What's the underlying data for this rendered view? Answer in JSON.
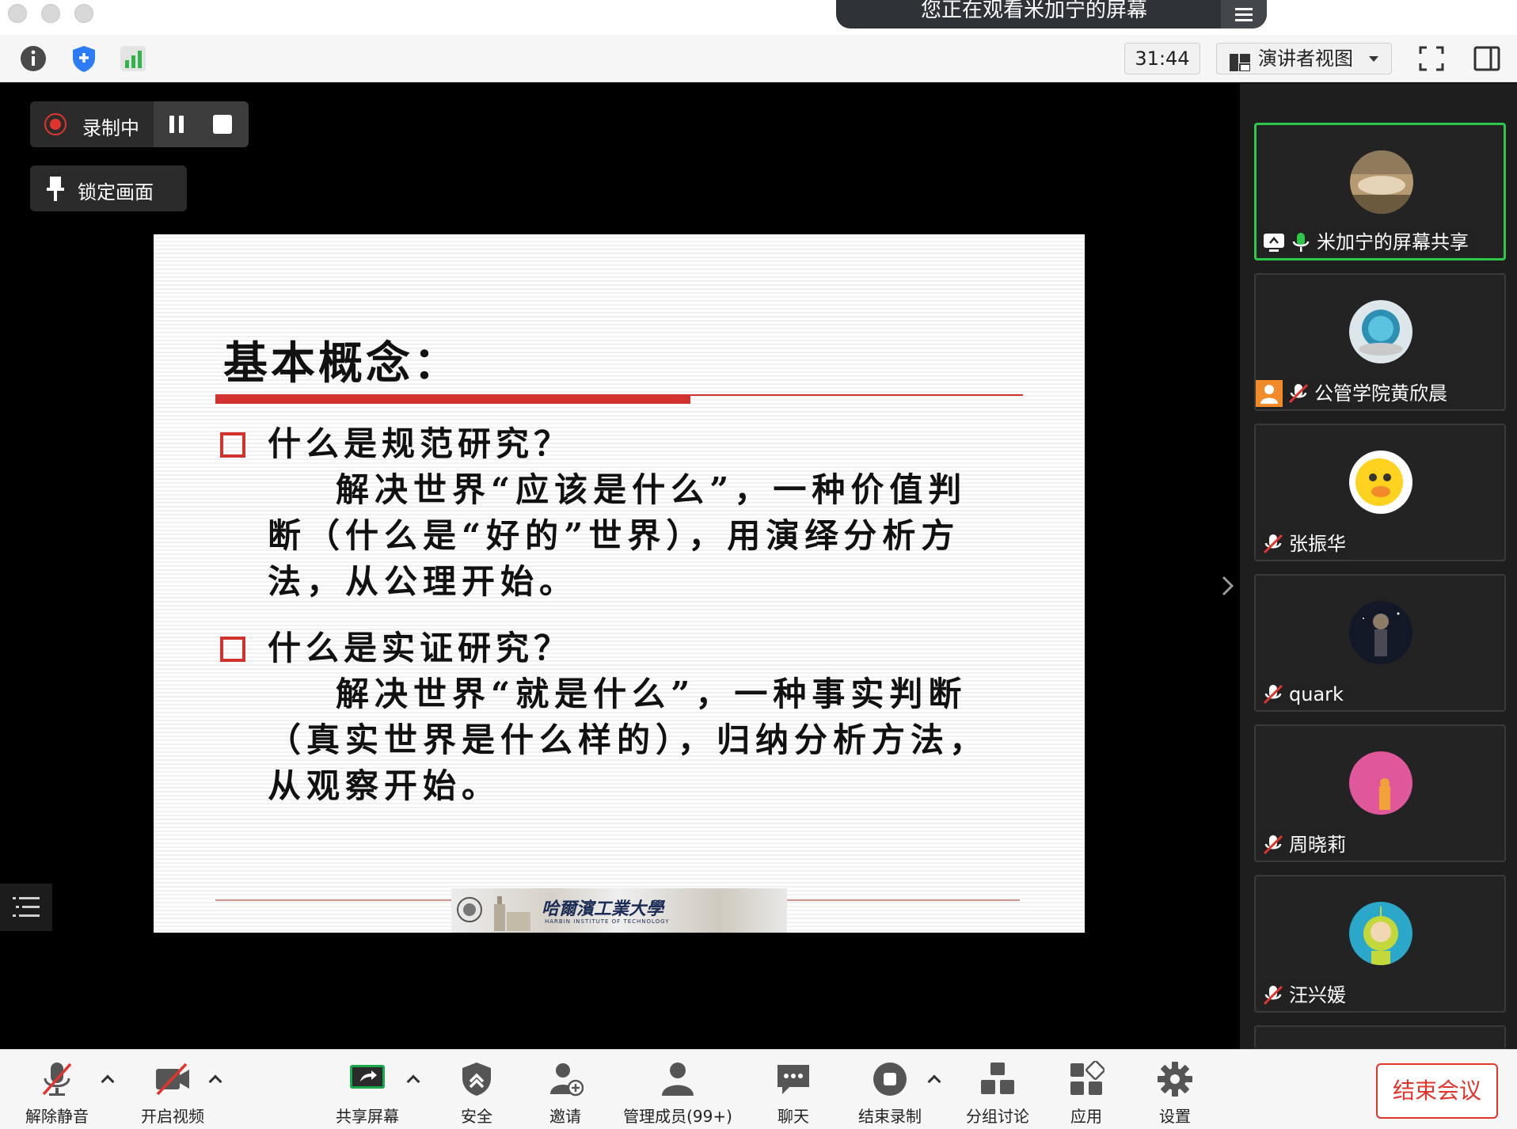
{
  "banner": {
    "viewing_text": "您正在观看米加宁的屏幕"
  },
  "toolbar": {
    "timer": "31:44",
    "view_mode": "演讲者视图"
  },
  "recording": {
    "status_label": "录制中"
  },
  "lock_screen_label": "锁定画面",
  "slide": {
    "title": "基本概念：",
    "q1": "什么是规范研究？",
    "a1_lines": [
      "解决世界“应该是什么”，一种价值判",
      "断（什么是“好的”世界），用演绎分析方",
      "法，从公理开始。"
    ],
    "q2": "什么是实证研究？",
    "a2_lines": [
      "解决世界“就是什么”，一种事实判断",
      "（真实世界是什么样的），归纳分析方法，",
      "从观察开始。"
    ],
    "university": "哈爾濱工業大學",
    "university_en": "HARBIN INSTITUTE OF TECHNOLOGY"
  },
  "participants": [
    {
      "name": "米加宁的屏幕共享",
      "active": true
    },
    {
      "name": "公管学院黄欣晨",
      "active": false
    },
    {
      "name": "张振华",
      "active": false
    },
    {
      "name": "quark",
      "active": false
    },
    {
      "name": "周晓莉",
      "active": false
    },
    {
      "name": "汪兴媛",
      "active": false
    }
  ],
  "controls": {
    "unmute": "解除静音",
    "video": "开启视频",
    "share": "共享屏幕",
    "security": "安全",
    "invite": "邀请",
    "participants": "管理成员(99+)",
    "chat": "聊天",
    "end_record": "结束录制",
    "breakout": "分组讨论",
    "apps": "应用",
    "settings": "设置",
    "end_meeting": "结束会议"
  },
  "colors": {
    "accent_green": "#2ec74a",
    "record_red": "#e0342c",
    "slide_red": "#d2322d"
  }
}
